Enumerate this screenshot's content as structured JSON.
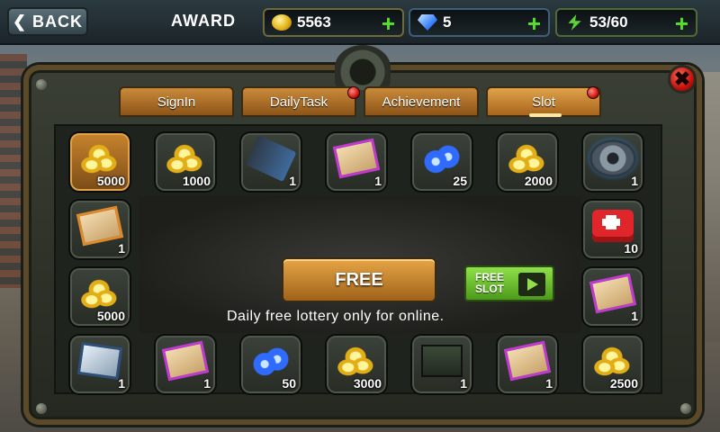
{
  "header": {
    "back_label": "BACK",
    "title": "AWARD",
    "resources": {
      "coins": "5563",
      "gems": "5",
      "energy": "53/60"
    }
  },
  "tabs": [
    {
      "label": "SignIn",
      "active": false,
      "badge": false
    },
    {
      "label": "DailyTask",
      "active": false,
      "badge": true
    },
    {
      "label": "Achievement",
      "active": false,
      "badge": false
    },
    {
      "label": "Slot",
      "active": true,
      "badge": true
    }
  ],
  "slots": {
    "top": [
      {
        "item": "gold-coins-icon",
        "qty": "5000",
        "highlight": true
      },
      {
        "item": "gold-coins-icon",
        "qty": "1000"
      },
      {
        "item": "sniper-rifle-icon",
        "qty": "1"
      },
      {
        "item": "blueprint-scroll-icon",
        "qty": "1"
      },
      {
        "item": "blue-gems-icon",
        "qty": "25"
      },
      {
        "item": "gold-coins-icon",
        "qty": "2000"
      },
      {
        "item": "gear-part-icon",
        "qty": "1"
      }
    ],
    "left": [
      {
        "item": "blueprint-scroll-icon",
        "qty": "1"
      },
      {
        "item": "gold-coins-icon",
        "qty": "5000"
      }
    ],
    "right": [
      {
        "item": "medkit-icon",
        "qty": "10"
      },
      {
        "item": "blueprint-scroll-icon",
        "qty": "1"
      }
    ],
    "bottom": [
      {
        "item": "armor-plate-icon",
        "qty": "1"
      },
      {
        "item": "blueprint-scroll-icon",
        "qty": "1"
      },
      {
        "item": "blue-gems-icon",
        "qty": "50"
      },
      {
        "item": "gold-coins-icon",
        "qty": "3000"
      },
      {
        "item": "ammo-crate-icon",
        "qty": "1"
      },
      {
        "item": "blueprint-scroll-icon",
        "qty": "1"
      },
      {
        "item": "gold-coins-icon",
        "qty": "2500"
      }
    ]
  },
  "center": {
    "free_button": "FREE",
    "free_slot_line1": "FREE",
    "free_slot_line2": "SLOT",
    "info": "Daily free lottery only for online."
  }
}
